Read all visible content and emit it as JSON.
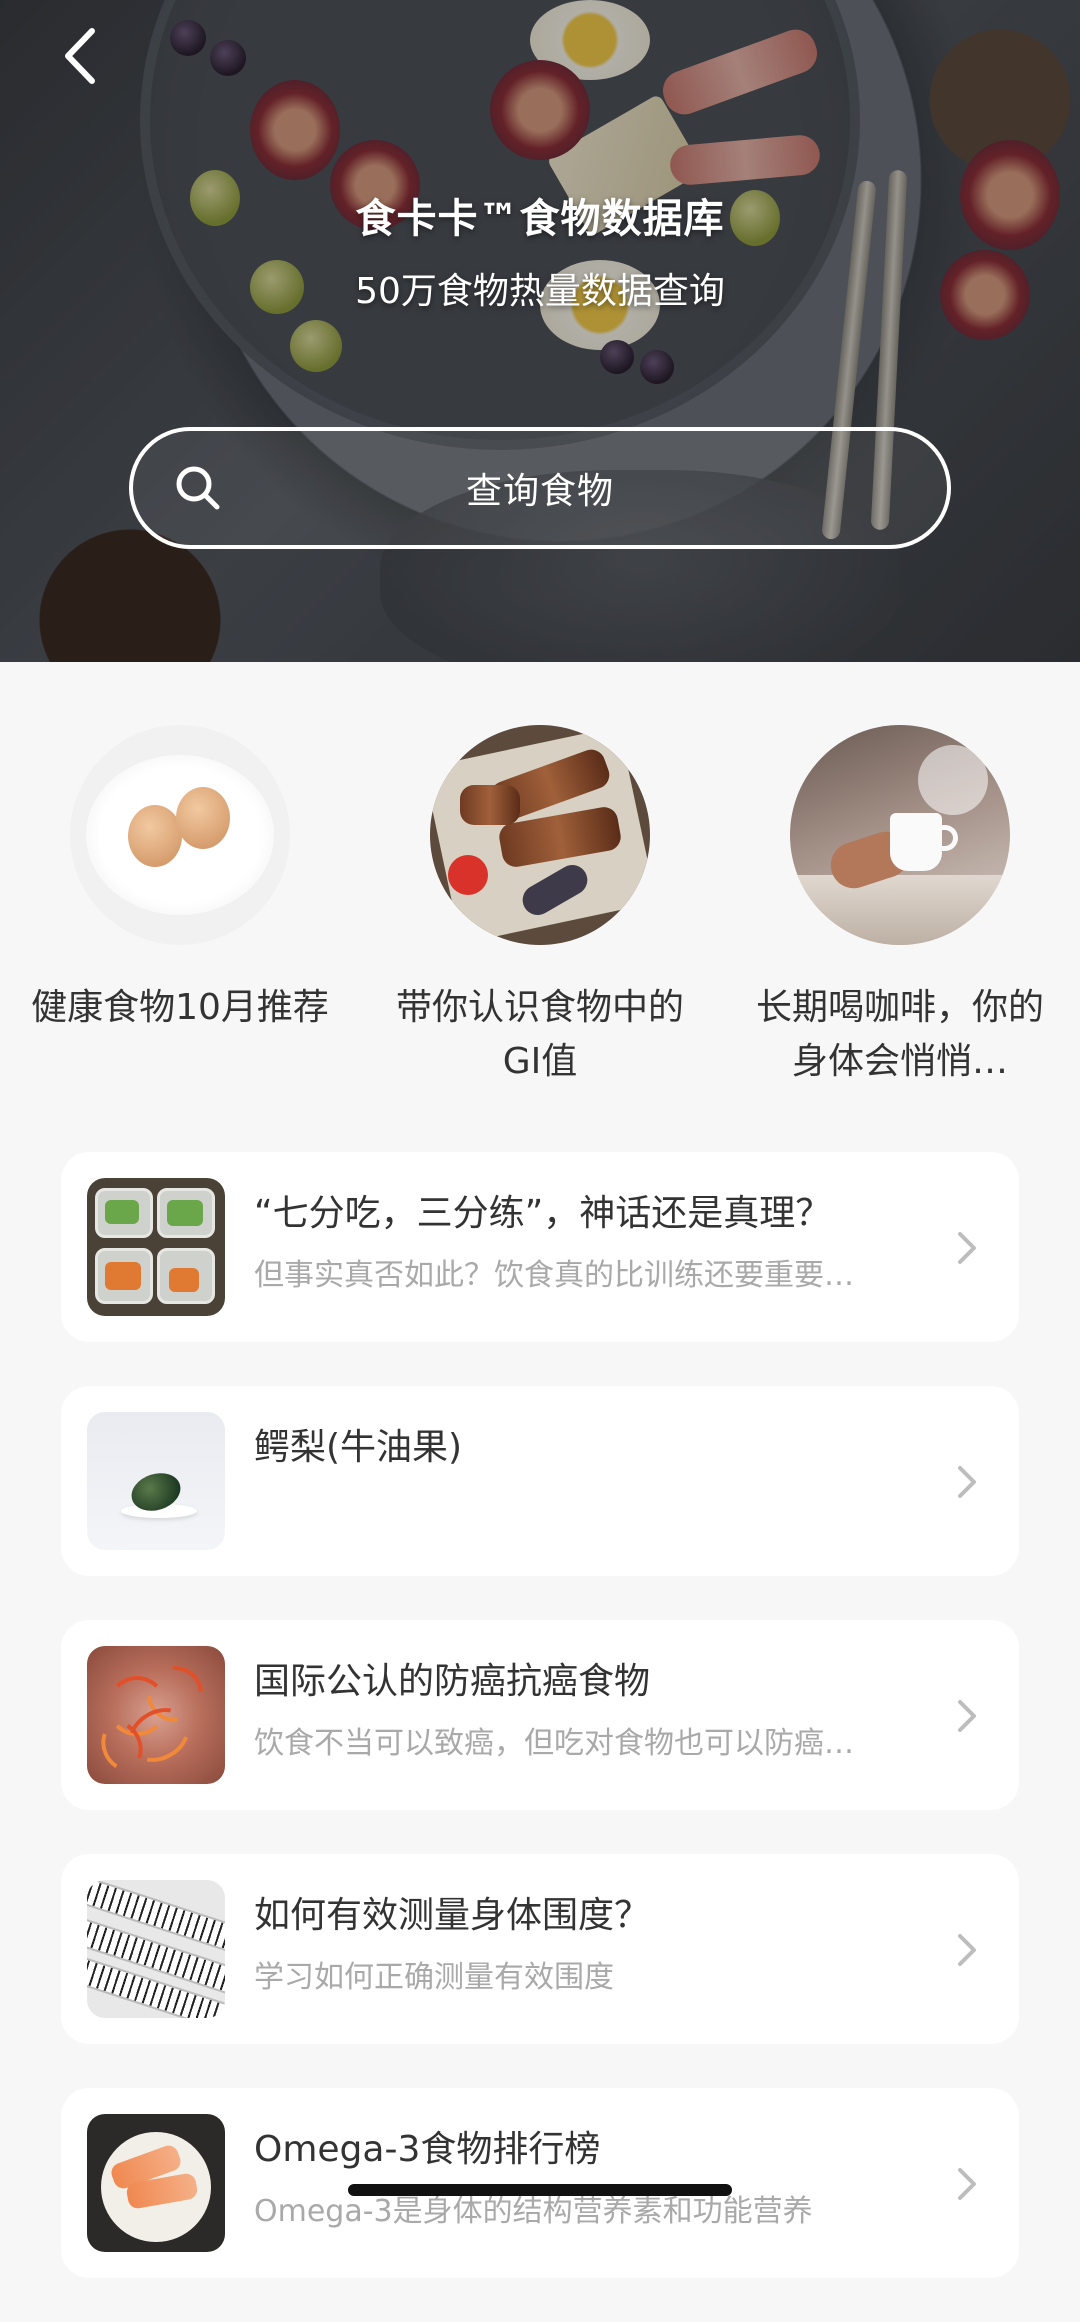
{
  "header": {
    "title": "食卡卡™食物数据库",
    "subtitle": "50万食物热量数据查询",
    "back_icon": "chevron-left-icon"
  },
  "search": {
    "placeholder": "查询食物",
    "icon": "search-icon"
  },
  "featured": [
    {
      "label": "健康食物10月推荐",
      "image": "eggs-on-plate"
    },
    {
      "label": "带你认识食物中的GI值",
      "image": "barbecue-platter"
    },
    {
      "label": "长期喝咖啡，你的身体会悄悄…",
      "image": "coffee-cup-in-hand"
    }
  ],
  "articles": [
    {
      "title": "“七分吃，三分练”，神话还是真理？",
      "subtitle": "但事实真否如此？饮食真的比训练还要重要…",
      "image": "meal-prep-boxes"
    },
    {
      "title": "鳄梨(牛油果)",
      "subtitle": "",
      "image": "avocado-on-plate"
    },
    {
      "title": "国际公认的防癌抗癌食物",
      "subtitle": "饮食不当可以致癌，但吃对食物也可以防癌…",
      "image": "saffron-herb"
    },
    {
      "title": "如何有效测量身体围度？",
      "subtitle": "学习如何正确测量有效围度",
      "image": "measuring-tape"
    },
    {
      "title": "Omega-3食物排行榜",
      "subtitle": "Omega-3是身体的结构营养素和功能营养",
      "image": "salmon-bowl"
    }
  ],
  "colors": {
    "background": "#f7f7f8",
    "card": "#ffffff",
    "title_text": "#333333",
    "subtitle_text": "#a9a9a9",
    "chevron": "#bdbdbd"
  }
}
